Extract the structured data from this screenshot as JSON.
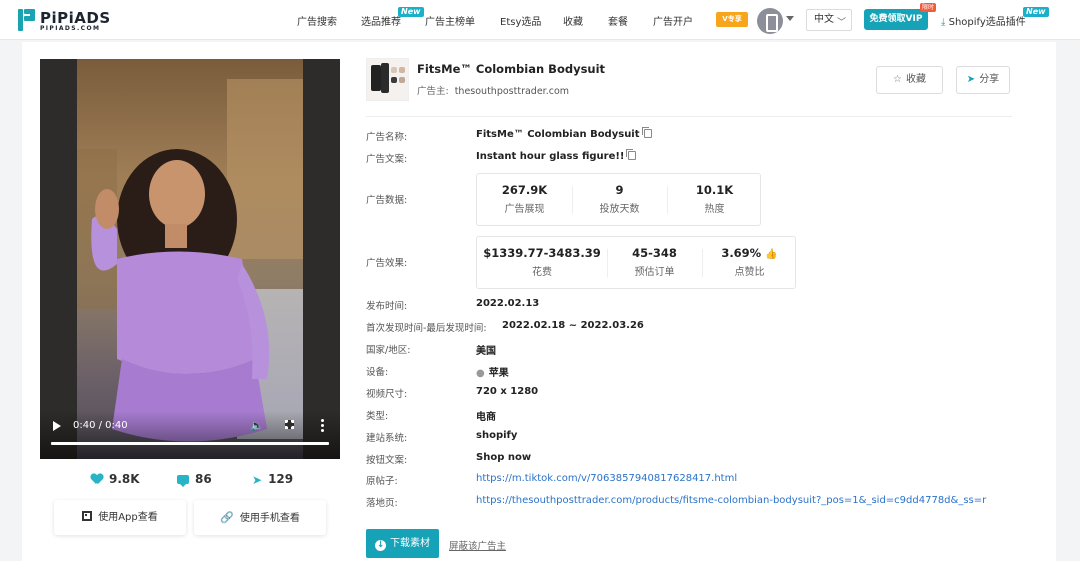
{
  "header": {
    "logo_text": "PiPiADS",
    "logo_sub": "PIPIADS.COM",
    "nav": [
      {
        "label": "广告搜索"
      },
      {
        "label": "选品推荐",
        "badge": "New"
      },
      {
        "label": "广告主榜单"
      },
      {
        "label": "Etsy选品"
      },
      {
        "label": "收藏"
      },
      {
        "label": "套餐"
      },
      {
        "label": "广告开户"
      }
    ],
    "vip_icon_text": "V专享",
    "language": "中文",
    "vip_button": "免费领取VIP",
    "vip_hot_badge": "限时",
    "shopify_plugin": "Shopify选品插件",
    "shopify_badge": "New",
    "accent_color": "#16a3b8"
  },
  "video": {
    "time": "0:40 / 0:40",
    "progress_fraction": 1.0
  },
  "engagement": {
    "likes": "9.8K",
    "comments": "86",
    "shares": "129"
  },
  "view_buttons": {
    "app": "使用App查看",
    "mobile": "使用手机查看"
  },
  "ad": {
    "title": "FitsMe™ Colombian Bodysuit",
    "advertiser_label": "广告主:",
    "advertiser": "thesouthposttrader.com",
    "favorite_label": "收藏",
    "share_label": "分享"
  },
  "details": {
    "name_label": "广告名称:",
    "name_value": "FitsMe™ Colombian Bodysuit",
    "copy_label": "广告文案:",
    "copy_value": "Instant hour glass figure!!",
    "data_label": "广告数据:",
    "data_metrics": [
      {
        "num": "267.9K",
        "cap": "广告展现"
      },
      {
        "num": "9",
        "cap": "投放天数"
      },
      {
        "num": "10.1K",
        "cap": "热度"
      }
    ],
    "effect_label": "广告效果:",
    "effect_metrics": [
      {
        "num": "$1339.77-3483.39",
        "cap": "花费"
      },
      {
        "num": "45-348",
        "cap": "预估订单"
      },
      {
        "num": "3.69%",
        "cap": "点赞比"
      }
    ],
    "publish_label": "发布时间:",
    "publish_value": "2022.02.13",
    "first_last_label": "首次发现时间-最后发现时间:",
    "first_last_value": "2022.02.18 ~ 2022.03.26",
    "country_label": "国家/地区:",
    "country_value": "美国",
    "device_label": "设备:",
    "device_value": "苹果",
    "size_label": "视频尺寸:",
    "size_value": "720 x 1280",
    "type_label": "类型:",
    "type_value": "电商",
    "site_label": "建站系统:",
    "site_value": "shopify",
    "button_label": "按钮文案:",
    "button_value": "Shop now",
    "original_label": "原帖子:",
    "original_url": "https://m.tiktok.com/v/7063857940817628417.html",
    "landing_label": "落地页:",
    "landing_url": "https://thesouthposttrader.com/products/fitsme-colombian-bodysuit?_pos=1&_sid=c9dd4778d&_ss=r"
  },
  "actions": {
    "download": "下载素材",
    "block": "屏蔽该广告主"
  }
}
